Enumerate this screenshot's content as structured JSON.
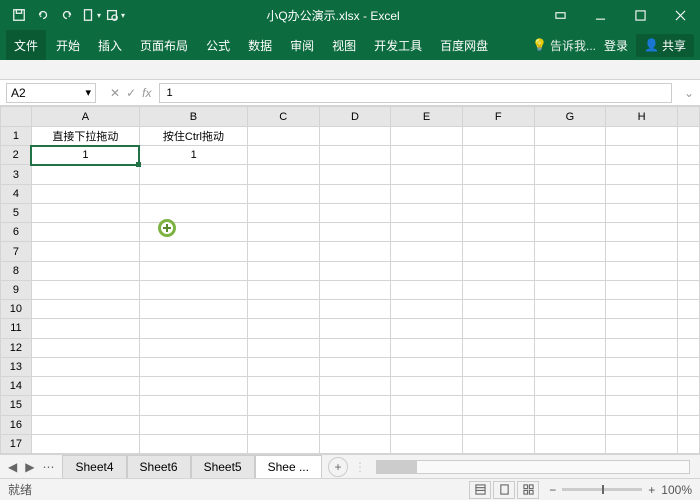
{
  "title": "小Q办公演示.xlsx - Excel",
  "ribbon": {
    "file": "文件",
    "tabs": [
      "开始",
      "插入",
      "页面布局",
      "公式",
      "数据",
      "审阅",
      "视图",
      "开发工具",
      "百度网盘"
    ],
    "tell": "告诉我...",
    "login": "登录",
    "share": "共享"
  },
  "namebox": "A2",
  "formula": "1",
  "columns": [
    "A",
    "B",
    "C",
    "D",
    "E",
    "F",
    "G",
    "H"
  ],
  "rows": [
    1,
    2,
    3,
    4,
    5,
    6,
    7,
    8,
    9,
    10,
    11,
    12,
    13,
    14,
    15,
    16,
    17
  ],
  "cells": {
    "A1": "直接下拉拖动",
    "B1": "按住Ctrl拖动",
    "A2": "1",
    "B2": "1"
  },
  "selected": "A2",
  "sheets": [
    "Sheet4",
    "Sheet6",
    "Sheet5",
    "Shee ..."
  ],
  "status": {
    "ready": "就绪",
    "zoom": "100%"
  }
}
